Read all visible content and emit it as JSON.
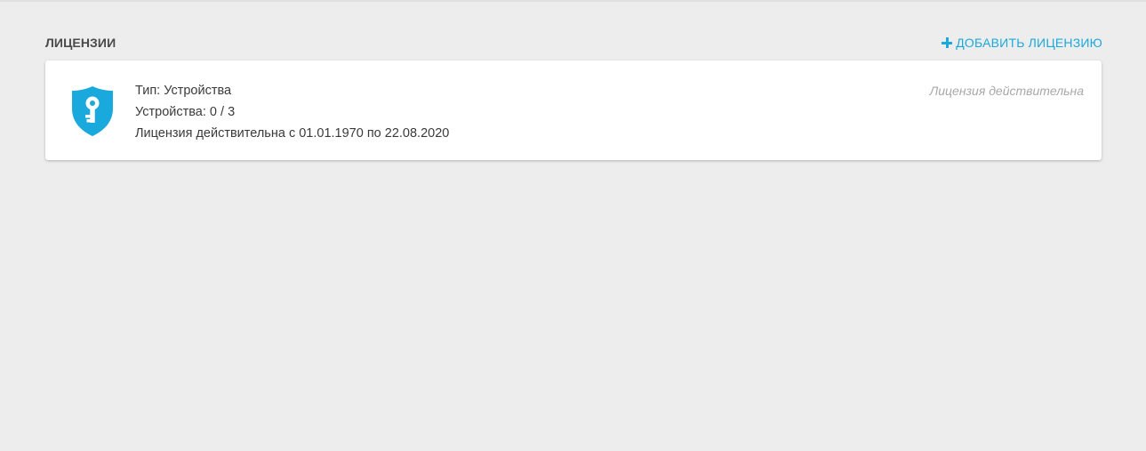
{
  "header": {
    "title": "ЛИЦЕНЗИИ",
    "add_button_label": "ДОБАВИТЬ ЛИЦЕНЗИЮ"
  },
  "license_card": {
    "icon": "shield-key-icon",
    "type_line": "Тип: Устройства",
    "devices_line": "Устройства: 0 / 3",
    "validity_line": "Лицензия действительна с 01.01.1970 по 22.08.2020",
    "status": "Лицензия действительна"
  },
  "colors": {
    "accent": "#1aa9dc",
    "background": "#ededed",
    "card": "#ffffff",
    "text": "#3a3a3a",
    "muted": "#a8a8a8"
  }
}
